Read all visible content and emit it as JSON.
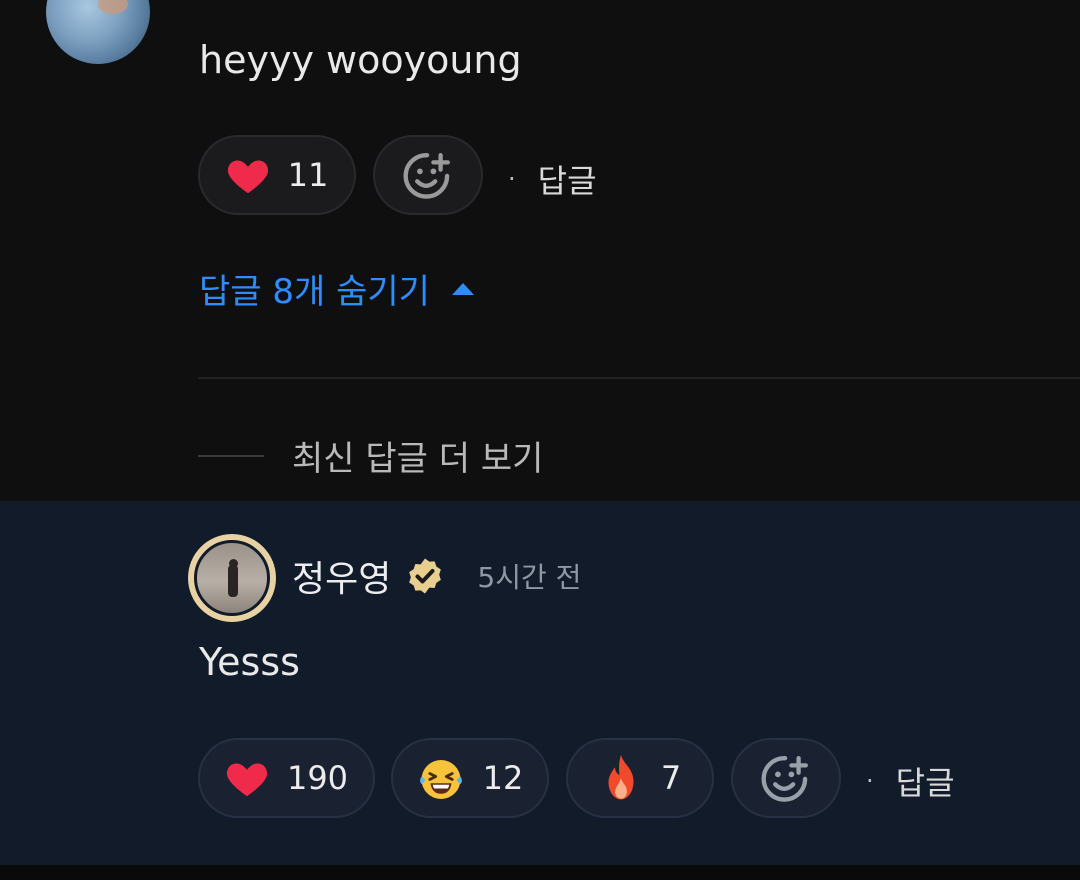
{
  "top_comment": {
    "text": "heyyy wooyoung",
    "reactions": [
      {
        "icon": "heart-icon",
        "count": "11"
      }
    ],
    "reply_label": "답글"
  },
  "replies_toggle": {
    "label": "답글 8개 숨기기"
  },
  "more_replies": {
    "label": "최신 답글 더 보기"
  },
  "reply": {
    "author": "정우영",
    "verified": true,
    "time": "5시간 전",
    "text": "Yesss",
    "reactions": [
      {
        "icon": "heart-icon",
        "count": "190"
      },
      {
        "icon": "laughing-emoji-icon",
        "count": "12"
      },
      {
        "icon": "fire-icon",
        "count": "7"
      }
    ],
    "reply_label": "답글"
  },
  "colors": {
    "accent_blue": "#2f8cff",
    "heart": "#f02a4b",
    "panel": "#121b2a",
    "verified_badge": "#e9cf8f"
  }
}
